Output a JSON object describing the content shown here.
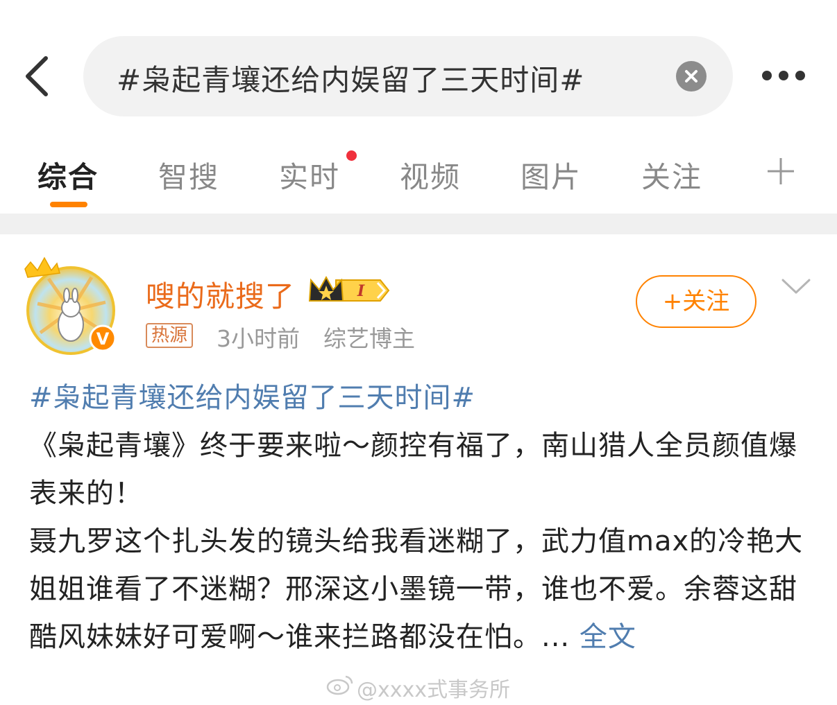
{
  "search": {
    "query": "#枭起青壤还给内娱留了三天时间#"
  },
  "tabs": [
    {
      "label": "综合",
      "active": true
    },
    {
      "label": "智搜"
    },
    {
      "label": "实时",
      "has_red_dot": true
    },
    {
      "label": "视频"
    },
    {
      "label": "图片"
    },
    {
      "label": "关注"
    }
  ],
  "post": {
    "author": "嗖的就搜了",
    "member_level": "I",
    "hot_badge": "热源",
    "time": "3小时前",
    "role": "综艺博主",
    "follow_label": "+关注",
    "hashtag": "#枭起青壤还给内娱留了三天时间#",
    "paragraphs": [
      "《枭起青壤》终于要来啦～颜控有福了，南山猎人全员颜值爆表来的！",
      "聂九罗这个扎头发的镜头给我看迷糊了，武力值max的冷艳大姐姐谁看了不迷糊？邢深这小墨镜一带，谁也不爱。余蓉这甜酷风妹妹好可爱啊～谁来拦路都没在怕。... "
    ],
    "full_text_label": "全文"
  },
  "watermark": "@xxxx式事务所",
  "colors": {
    "accent": "#ff8200",
    "link": "#507daf",
    "author_name": "#ea6a1a",
    "red_dot": "#f0303c"
  }
}
